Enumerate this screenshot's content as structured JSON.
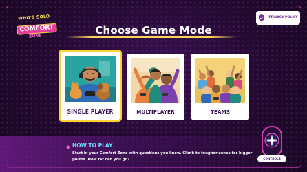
{
  "logo": {
    "line1": "WHO'S SOLO",
    "line2": "COMFORT",
    "line3": "ZONE"
  },
  "privacy": {
    "label": "PRIVACY POLICY"
  },
  "title": "Choose Game Mode",
  "modes": [
    {
      "label": "SINGLE PLAYER",
      "selected": true
    },
    {
      "label": "MULTIPLAYER",
      "selected": false
    },
    {
      "label": "TEAMS",
      "selected": false
    }
  ],
  "how_to_play": {
    "title": "HOW TO PLAY",
    "text": "Start in your Comfort Zone with questions you know. Climb to tougher zones for bigger points. How far can you go?"
  },
  "controls": {
    "label": "CONTROLS"
  },
  "colors": {
    "accent_yellow": "#ffd233",
    "accent_cyan": "#6fd8ff",
    "frame_pink": "#d03fb0",
    "background": "#22092f"
  },
  "icons": [
    "privacy-shield-icon",
    "gamepad-icon",
    "diamond-bullet-icon"
  ]
}
